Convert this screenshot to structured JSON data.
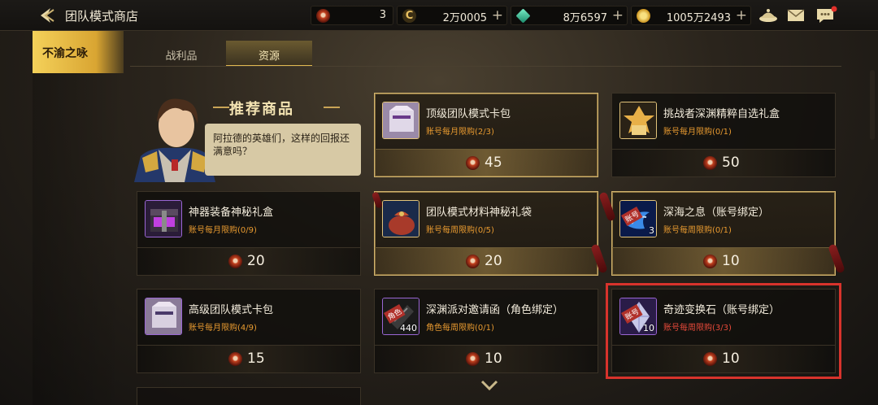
{
  "header": {
    "title": "团队模式商店",
    "resources": [
      {
        "icon": "team-coin-icon",
        "value": "3",
        "has_plus": false
      },
      {
        "icon": "gold-c-icon",
        "value": "2万0005",
        "has_plus": true
      },
      {
        "icon": "green-crystal-icon",
        "value": "8万6597",
        "has_plus": true
      },
      {
        "icon": "gold-coin-icon",
        "value": "1005万2493",
        "has_plus": true
      }
    ]
  },
  "sidebar": {
    "active_item": "不渝之咏"
  },
  "tabs": [
    {
      "label": "战利品",
      "active": false
    },
    {
      "label": "资源",
      "active": true
    }
  ],
  "recommend": {
    "title": "推荐商品",
    "speech": "阿拉德的英雄们，这样的回报还满意吗？"
  },
  "items": [
    {
      "name": "顶级团队模式卡包",
      "limit": "账号每月限购(2/3)",
      "price": "45",
      "quantity": "",
      "badge": "",
      "style": "gold",
      "limit_color": "orange",
      "icon": "card-pack-icon"
    },
    {
      "name": "挑战者深渊精粹自选礼盒",
      "limit": "账号每月限购(0/1)",
      "price": "50",
      "quantity": "",
      "badge": "",
      "style": "normal",
      "limit_color": "orange",
      "icon": "gold-gift-box-icon"
    },
    {
      "name": "神器装备神秘礼盒",
      "limit": "账号每月限购(0/9)",
      "price": "20",
      "quantity": "",
      "badge": "",
      "style": "normal",
      "limit_color": "orange",
      "icon": "purple-chest-icon"
    },
    {
      "name": "团队模式材料神秘礼袋",
      "limit": "账号每周限购(0/5)",
      "price": "20",
      "quantity": "",
      "badge": "",
      "style": "gold",
      "limit_color": "orange",
      "icon": "material-bag-icon"
    },
    {
      "name": "深海之息（账号绑定）",
      "limit": "账号每周限购(0/1)",
      "price": "10",
      "quantity": "3",
      "badge": "账号",
      "style": "gold",
      "limit_color": "orange",
      "icon": "deep-sea-breath-icon"
    },
    {
      "name": "高级团队模式卡包",
      "limit": "账号每月限购(4/9)",
      "price": "15",
      "quantity": "",
      "badge": "",
      "style": "normal",
      "limit_color": "orange",
      "icon": "card-pack-icon"
    },
    {
      "name": "深渊派对邀请函（角色绑定）",
      "limit": "角色每周限购(0/1)",
      "price": "10",
      "quantity": "440",
      "badge": "角色",
      "style": "normal",
      "limit_color": "orange",
      "icon": "abyss-invitation-icon"
    },
    {
      "name": "奇迹变换石（账号绑定）",
      "limit": "账号每周限购(3/3)",
      "price": "10",
      "quantity": "10",
      "badge": "账号",
      "style": "normal",
      "limit_color": "red",
      "icon": "miracle-stone-icon"
    }
  ]
}
